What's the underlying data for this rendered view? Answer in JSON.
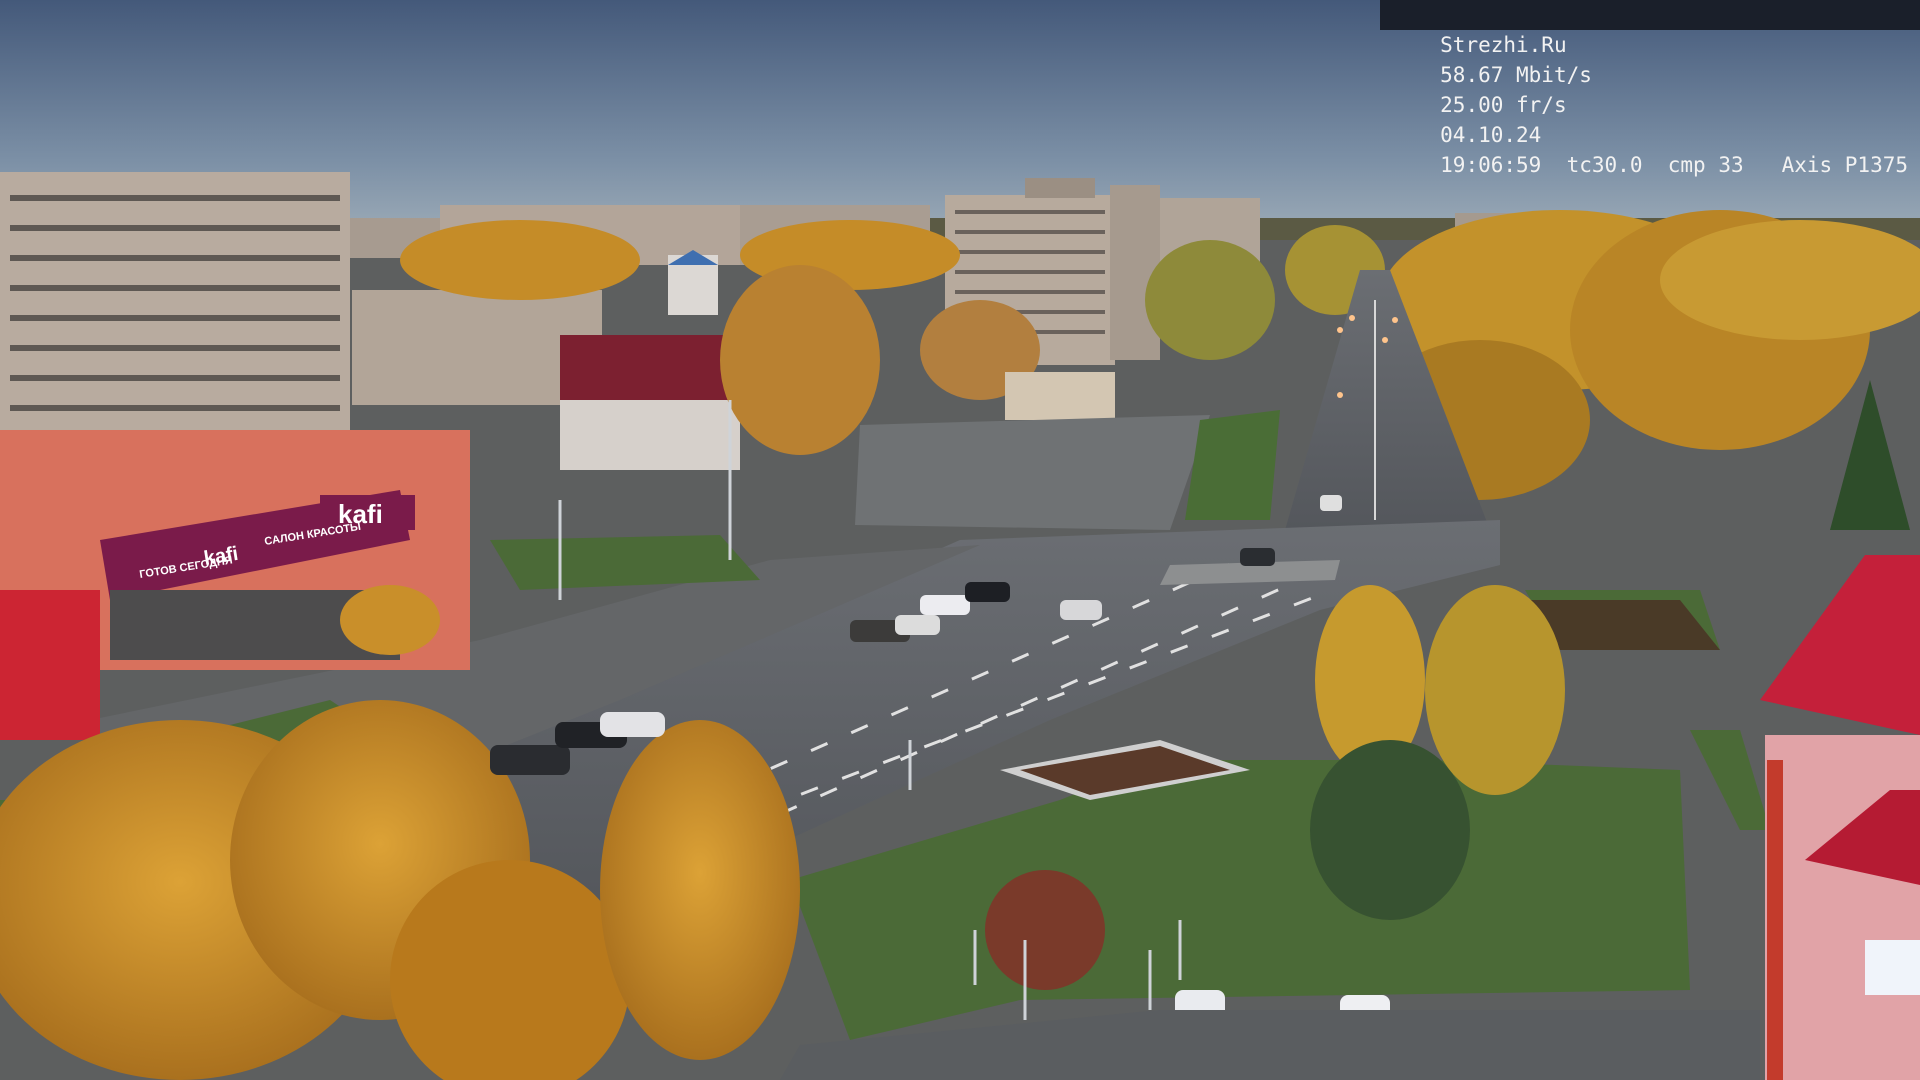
{
  "camera_overlay": {
    "site": "Strezhi.Ru",
    "bitrate": "58.67 Mbit/s",
    "framerate": "25.00 fr/s",
    "date": "04.10.24",
    "time": "19:06:59",
    "tc": "tc30.0",
    "cmp": "cmp 33",
    "camera_model": "Axis P1375"
  },
  "store_signs": {
    "main_logo": "kafi",
    "lower_logo": "kafi",
    "lower_tagline": "ГОТОВ СЕГОДНЯ",
    "upper_tagline": "САЛОН КРАСОТЫ"
  },
  "colors": {
    "sky_top": "#4a5f7c",
    "sky_bottom": "#93a5b5",
    "autumn_foliage": "#c98f2a",
    "store_brand": "#7a1b4a",
    "roof_red": "#c4203a"
  }
}
